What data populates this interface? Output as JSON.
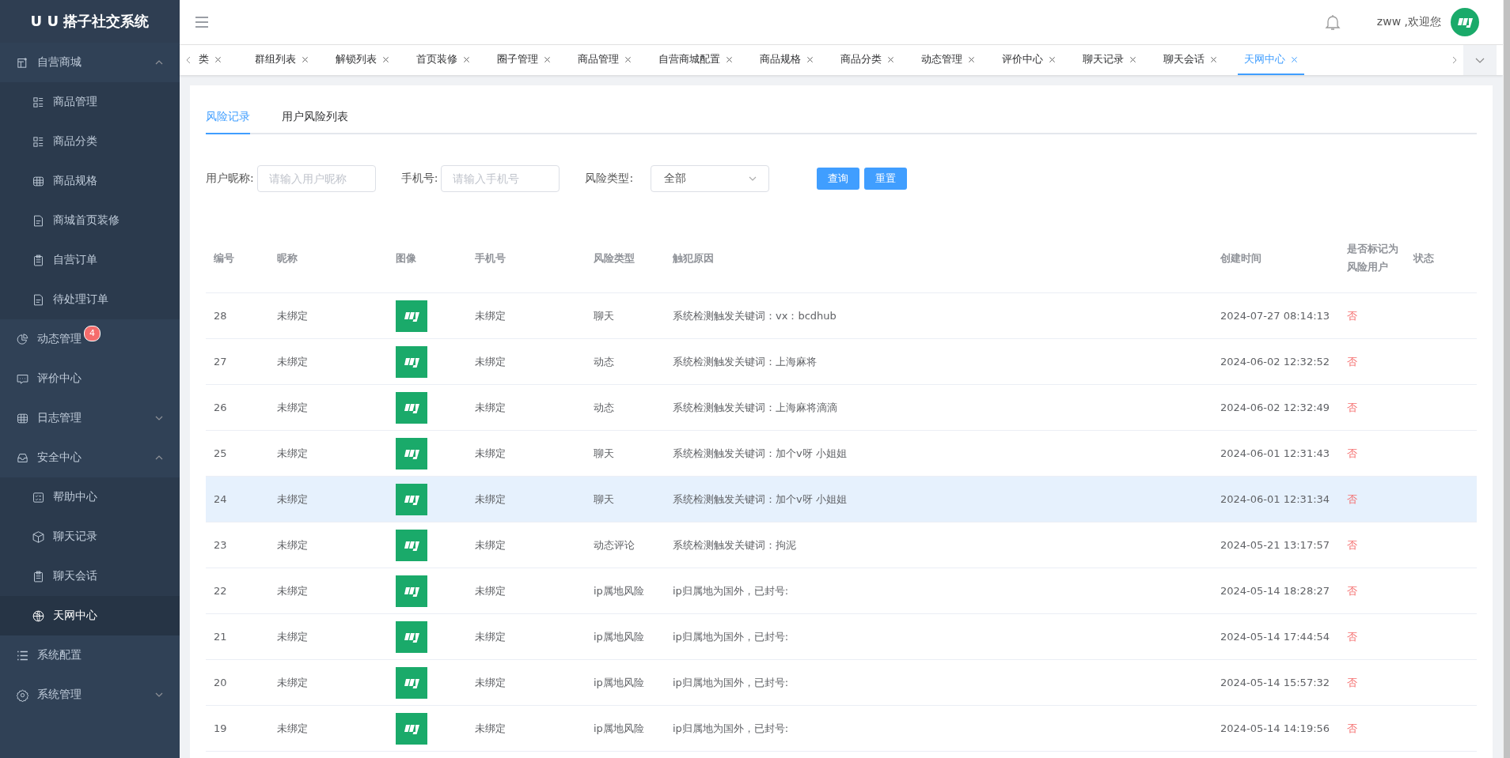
{
  "sidebar": {
    "title": "U U 搭子社交系统",
    "items": [
      {
        "label": "自营商城",
        "expanded": true,
        "children": [
          {
            "label": "商品管理",
            "selected": false
          },
          {
            "label": "商品分类",
            "selected": false
          },
          {
            "label": "商品规格",
            "selected": false
          },
          {
            "label": "商城首页装修",
            "selected": false
          },
          {
            "label": "自营订单",
            "selected": false
          },
          {
            "label": "待处理订单",
            "selected": false
          }
        ]
      },
      {
        "label": "动态管理",
        "badge": "4"
      },
      {
        "label": "评价中心"
      },
      {
        "label": "日志管理",
        "expanded": false
      },
      {
        "label": "安全中心",
        "expanded": true,
        "children": [
          {
            "label": "帮助中心",
            "selected": false
          },
          {
            "label": "聊天记录",
            "selected": false
          },
          {
            "label": "聊天会话",
            "selected": false
          },
          {
            "label": "天网中心",
            "selected": true
          }
        ]
      },
      {
        "label": "系统配置"
      },
      {
        "label": "系统管理",
        "expanded": false
      }
    ]
  },
  "header": {
    "greeting": "zww ,欢迎您"
  },
  "tags": [
    {
      "label": "类",
      "selected": false
    },
    {
      "label": "群组列表",
      "selected": false
    },
    {
      "label": "解锁列表",
      "selected": false
    },
    {
      "label": "首页装修",
      "selected": false
    },
    {
      "label": "圈子管理",
      "selected": false
    },
    {
      "label": "商品管理",
      "selected": false
    },
    {
      "label": "自营商城配置",
      "selected": false
    },
    {
      "label": "商品规格",
      "selected": false
    },
    {
      "label": "商品分类",
      "selected": false
    },
    {
      "label": "动态管理",
      "selected": false
    },
    {
      "label": "评价中心",
      "selected": false
    },
    {
      "label": "聊天记录",
      "selected": false
    },
    {
      "label": "聊天会话",
      "selected": false
    },
    {
      "label": "天网中心",
      "selected": true
    }
  ],
  "tabs": [
    {
      "label": "风险记录",
      "selected": true
    },
    {
      "label": "用户风险列表",
      "selected": false
    }
  ],
  "filters": [
    {
      "label": "用户昵称:",
      "kind": "input",
      "placeholder": "请输入用户昵称"
    },
    {
      "label": "手机号:",
      "kind": "input",
      "placeholder": "请输入手机号"
    },
    {
      "label": "风险类型:",
      "kind": "select",
      "value": "全部"
    }
  ],
  "buttons": [
    "查询",
    "重置"
  ],
  "table": {
    "columns": [
      "编号",
      "昵称",
      "图像",
      "手机号",
      "风险类型",
      "触犯原因",
      "创建时间",
      "是否标记为风险用户",
      "状态"
    ],
    "rows": [
      {
        "id": "28",
        "nickname": "未绑定",
        "phone": "未绑定",
        "type": "聊天",
        "reason": "系统检测触发关键词：vx：bcdhub",
        "created": "2024-07-27 08:14:13",
        "flagged": "否",
        "selected": false
      },
      {
        "id": "27",
        "nickname": "未绑定",
        "phone": "未绑定",
        "type": "动态",
        "reason": "系统检测触发关键词：上海麻将",
        "created": "2024-06-02 12:32:52",
        "flagged": "否",
        "selected": false
      },
      {
        "id": "26",
        "nickname": "未绑定",
        "phone": "未绑定",
        "type": "动态",
        "reason": "系统检测触发关键词：上海麻将滴滴",
        "created": "2024-06-02 12:32:49",
        "flagged": "否",
        "selected": false
      },
      {
        "id": "25",
        "nickname": "未绑定",
        "phone": "未绑定",
        "type": "聊天",
        "reason": "系统检测触发关键词：加个v呀 小姐姐",
        "created": "2024-06-01 12:31:43",
        "flagged": "否",
        "selected": false
      },
      {
        "id": "24",
        "nickname": "未绑定",
        "phone": "未绑定",
        "type": "聊天",
        "reason": "系统检测触发关键词：加个v呀 小姐姐",
        "created": "2024-06-01 12:31:34",
        "flagged": "否",
        "selected": true
      },
      {
        "id": "23",
        "nickname": "未绑定",
        "phone": "未绑定",
        "type": "动态评论",
        "reason": "系统检测触发关键词：拘泥",
        "created": "2024-05-21 13:17:57",
        "flagged": "否",
        "selected": false
      },
      {
        "id": "22",
        "nickname": "未绑定",
        "phone": "未绑定",
        "type": "ip属地风险",
        "reason": "ip归属地为国外，已封号:",
        "created": "2024-05-14 18:28:27",
        "flagged": "否",
        "selected": false
      },
      {
        "id": "21",
        "nickname": "未绑定",
        "phone": "未绑定",
        "type": "ip属地风险",
        "reason": "ip归属地为国外，已封号:",
        "created": "2024-05-14 17:44:54",
        "flagged": "否",
        "selected": false
      },
      {
        "id": "20",
        "nickname": "未绑定",
        "phone": "未绑定",
        "type": "ip属地风险",
        "reason": "ip归属地为国外，已封号:",
        "created": "2024-05-14 15:57:32",
        "flagged": "否",
        "selected": false
      },
      {
        "id": "19",
        "nickname": "未绑定",
        "phone": "未绑定",
        "type": "ip属地风险",
        "reason": "ip归属地为国外，已封号:",
        "created": "2024-05-14 14:19:56",
        "flagged": "否",
        "selected": false
      }
    ]
  }
}
